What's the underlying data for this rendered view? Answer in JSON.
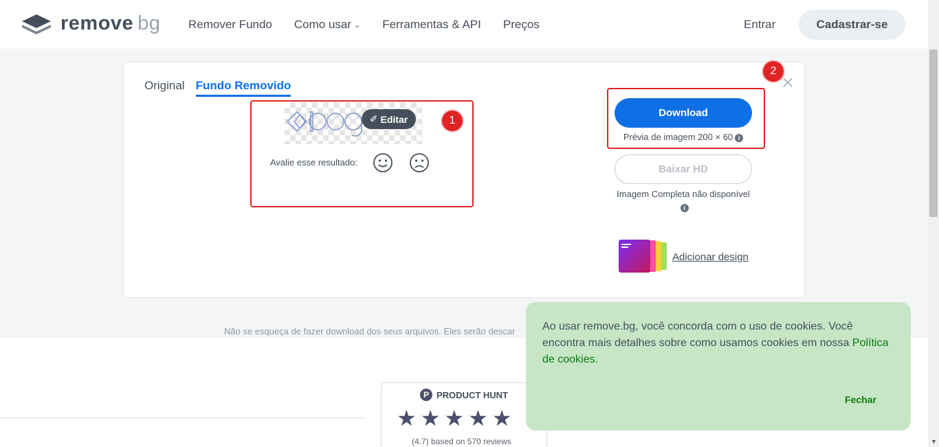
{
  "header": {
    "logo_main": "remove",
    "logo_sub": "bg",
    "nav": [
      "Remover Fundo",
      "Como usar",
      "Ferramentas & API",
      "Preços"
    ],
    "login": "Entrar",
    "signup": "Cadastrar-se"
  },
  "card": {
    "tabs": [
      "Original",
      "Fundo Removido"
    ],
    "active_tab": "Fundo Removido",
    "edit_label": "Editar",
    "rate_label": "Avalie esse resultado:",
    "download_label": "Download",
    "preview_size": "Prévia de imagem 200 × 60",
    "hd_label": "Baixar HD",
    "hd_note": "Imagem Completa não disponível",
    "design_link": "Adicionar design",
    "badge_1": "1",
    "badge_2": "2"
  },
  "reminder": "Não se esqueça de fazer download dos seus arquivos. Eles serão descar",
  "product_hunt": {
    "title": "PRODUCT HUNT",
    "stars": "★★★★★",
    "reviews": "(4.7) based on 570 reviews"
  },
  "cookie": {
    "text": "Ao usar remove.bg, você concorda com o uso de cookies. Você encontra mais detalhes sobre como usamos cookies em nossa",
    "link": "Política de cookies.",
    "close": "Fechar"
  },
  "colors": {
    "primary": "#0f70e6",
    "annotation_red": "#e02424",
    "cookie_bg": "#c6e6c6",
    "cookie_link": "#0c7a0c"
  }
}
